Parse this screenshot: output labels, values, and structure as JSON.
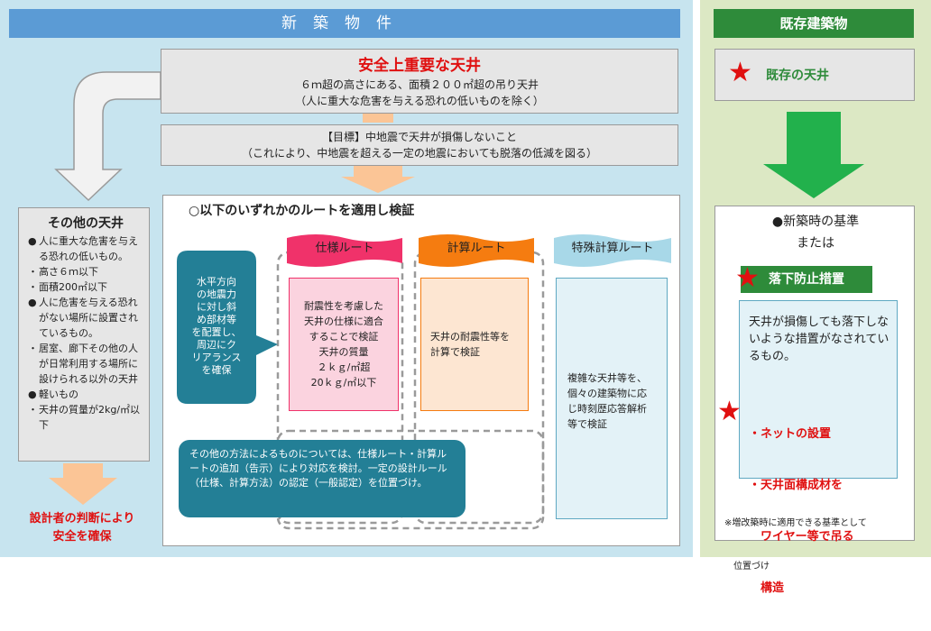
{
  "new_section": {
    "header": "新築物件",
    "important": {
      "title": "安全上重要な天井",
      "line1": "６ｍ超の高さにある、面積２００㎡超の吊り天井",
      "line2": "（人に重大な危害を与える恐れの低いものを除く）"
    },
    "goal": {
      "line1": "【目標】中地震で天井が損傷しないこと",
      "line2": "（これにより、中地震を超える一定の地震においても脱落の低減を図る）"
    },
    "other": {
      "title": "その他の天井",
      "items": [
        {
          "marker": "●",
          "text": "人に重大な危害を与える恐れの低いもの。"
        },
        {
          "marker": "・",
          "text": "高さ６ｍ以下"
        },
        {
          "marker": "・",
          "text": "面積200㎡以下"
        },
        {
          "marker": "●",
          "text": "人に危害を与える恐れがない場所に設置されているもの。"
        },
        {
          "marker": "・",
          "text": "居室、廊下その他の人が日常利用する場所に設けられる以外の天井"
        },
        {
          "marker": "●",
          "text": "軽いもの"
        },
        {
          "marker": "・",
          "text": "天井の質量が2kg/㎡以下"
        }
      ]
    },
    "designer_judgment": [
      "設計者の判断により",
      "安全を確保"
    ],
    "verification_title": "○以下のいずれかのルートを適用し検証",
    "routes": [
      {
        "label": "仕様ルート",
        "lines": [
          "耐震性を考慮した",
          "天井の仕様に適合",
          "することで検証",
          "天井の質量",
          "２ｋｇ/㎡超",
          "20ｋｇ/㎡以下"
        ]
      },
      {
        "label": "計算ルート",
        "lines": [
          "天井の耐震性等を",
          "計算で検証"
        ]
      },
      {
        "label": "特殊計算ルート",
        "lines": [
          "複雑な天井等を、",
          "個々の建築物に応",
          "じ時刻歴応答解析",
          "等で検証"
        ]
      }
    ],
    "horizontal_note": [
      "水平方向",
      "の地震力",
      "に対し斜",
      "め部材等",
      "を配置し、",
      "周辺にク",
      "リアランス",
      "を確保"
    ],
    "other_method_note": "その他の方法によるものについては、仕様ルート・計算ルートの追加（告示）により対応を検討。一定の設計ルール（仕様、計算方法）の認定（一般認定）を位置づけ。"
  },
  "existing_section": {
    "header": "既存建築物",
    "existing_ceiling": "既存の天井",
    "standard_line1": "●新築時の基準",
    "standard_line2": "または",
    "measure_label": "落下防止措置",
    "measure_desc": "天井が損傷しても落下しないような措置がなされているもの。",
    "examples": [
      "・ネットの設置",
      "・天井面構成材を",
      "　ワイヤー等で吊る",
      "　構造"
    ],
    "footnote": [
      "※増改築時に適用できる基準として",
      "　位置づけ"
    ]
  },
  "colors": {
    "header_blue": "#5b9bd5",
    "header_green": "#2e8b3a",
    "arrow_green": "#22b14c",
    "arrow_orange": "#fbc596",
    "red_text": "#e01010",
    "route_spec": "#f0326a",
    "route_calc": "#f57c10",
    "route_special": "#a8d8e8",
    "teal_note": "#237f96"
  }
}
